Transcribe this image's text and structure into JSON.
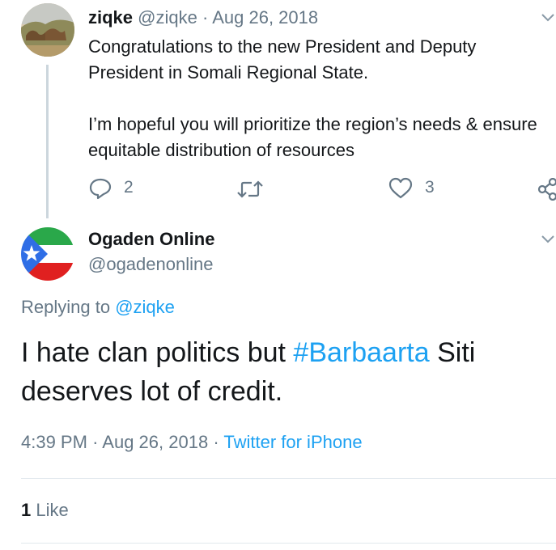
{
  "parent_tweet": {
    "display_name": "ziqke",
    "handle": "@ziqke",
    "separator": "·",
    "date": "Aug 26, 2018",
    "paragraph1": "Congratulations to the new President and Deputy President in Somali Regional State.",
    "paragraph2": "I’m hopeful you will prioritize the region’s needs & ensure equitable distribution of resources",
    "reply_count": "2",
    "retweet_count": "",
    "like_count": "3",
    "icons": [
      "reply-icon",
      "retweet-icon",
      "heart-icon",
      "share-icon",
      "chevron-down-icon"
    ]
  },
  "reply_tweet": {
    "display_name": "Ogaden Online",
    "handle": "@ogadenonline",
    "replying_prefix": "Replying to",
    "replying_to": "@ziqke",
    "text_before": "I hate clan politics but ",
    "hashtag": "#Barbaarta",
    "text_after": " Siti deserves lot of credit.",
    "time": "4:39 PM",
    "sep": "·",
    "date": "Aug 26, 2018",
    "source": "Twitter for iPhone",
    "like_count": "1",
    "like_label": "Like",
    "flag_colors": {
      "top": "#2aa84a",
      "middle": "#ffffff",
      "bottom": "#e02020",
      "triangle": "#2f6ee6"
    }
  },
  "colors": {
    "accent": "#1da1f2",
    "muted": "#657786",
    "text": "#14171a",
    "divider": "#e1e8ed"
  }
}
